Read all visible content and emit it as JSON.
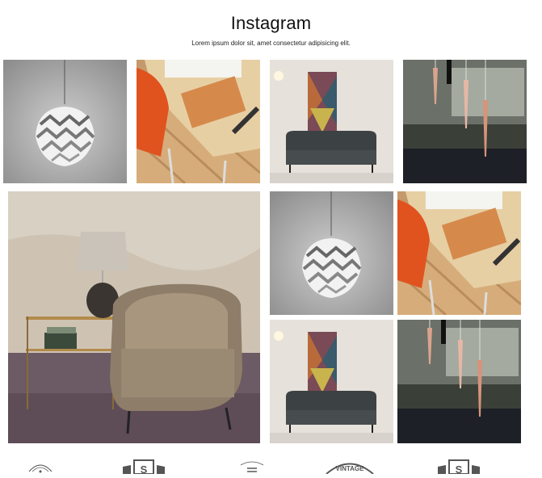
{
  "header": {
    "title": "Instagram",
    "subtitle": "Lorem ipsum dolor sit, amet consectetur adipisicing elit."
  },
  "gallery": {
    "tiles": [
      {
        "name": "instagram-photo-pendant-lamp",
        "subject": "white geometric pendant lamp"
      },
      {
        "name": "instagram-photo-desk",
        "subject": "wooden desk with orange chair"
      },
      {
        "name": "instagram-photo-sofa",
        "subject": "dark tufted sofa with art print"
      },
      {
        "name": "instagram-photo-copper-pendants",
        "subject": "copper pendant lights"
      },
      {
        "name": "instagram-photo-armchair",
        "subject": "leather armchair with table lamp"
      },
      {
        "name": "instagram-photo-pendant-lamp-2",
        "subject": "white geometric pendant lamp"
      },
      {
        "name": "instagram-photo-desk-2",
        "subject": "wooden desk with orange chair"
      },
      {
        "name": "instagram-photo-sofa-2",
        "subject": "dark tufted sofa with art print"
      },
      {
        "name": "instagram-photo-copper-pendants-2",
        "subject": "copper pendant lights"
      }
    ]
  },
  "brand_logos": {
    "items": [
      {
        "name": "brand-logo-1",
        "icon": "circle-badge-logo"
      },
      {
        "name": "brand-logo-2",
        "icon": "s-banner-logo",
        "letter": "S"
      },
      {
        "name": "brand-logo-3",
        "icon": "lines-badge-logo"
      },
      {
        "name": "brand-logo-4",
        "icon": "vintage-badge-logo",
        "text": "VINTAGE"
      },
      {
        "name": "brand-logo-5",
        "icon": "s-banner-logo",
        "letter": "S"
      }
    ]
  },
  "colors": {
    "background": "#ffffff",
    "logo": "#555555"
  }
}
